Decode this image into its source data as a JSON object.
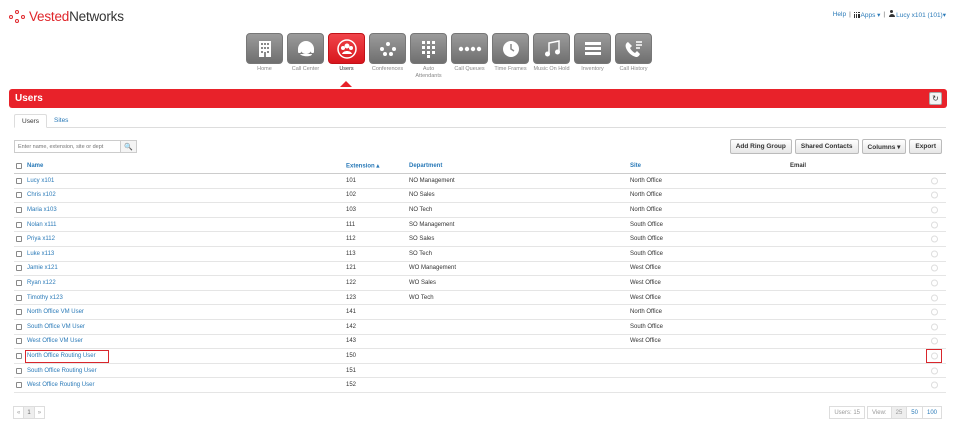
{
  "brand": {
    "name_first": "Vested",
    "name_second": "Networks"
  },
  "topbar": {
    "help": "Help",
    "sep": "|",
    "apps": "Apps",
    "user": "Lucy x101 (101)",
    "caret": "▾"
  },
  "nav": [
    {
      "label": "Home",
      "icon": "building-icon"
    },
    {
      "label": "Call Center",
      "icon": "headset-icon"
    },
    {
      "label": "Users",
      "icon": "users-icon",
      "active": true
    },
    {
      "label": "Conferences",
      "icon": "conference-icon"
    },
    {
      "label": "Auto Attendants",
      "icon": "keypad-icon"
    },
    {
      "label": "Call Queues",
      "icon": "queue-icon"
    },
    {
      "label": "Time Frames",
      "icon": "clock-icon"
    },
    {
      "label": "Music On Hold",
      "icon": "music-icon"
    },
    {
      "label": "Inventory",
      "icon": "inventory-icon"
    },
    {
      "label": "Call History",
      "icon": "call-history-icon"
    }
  ],
  "page": {
    "title": "Users",
    "refresh_icon": "↻"
  },
  "tabs": {
    "users": "Users",
    "sites": "Sites"
  },
  "search": {
    "placeholder": "Enter name, extension, site or dept",
    "icon": "🔍"
  },
  "toolbar": {
    "add_ring_group": "Add Ring Group",
    "shared_contacts": "Shared Contacts",
    "columns": "Columns ▾",
    "export": "Export"
  },
  "table": {
    "headers": {
      "name": "Name",
      "extension": "Extension ▴",
      "department": "Department",
      "site": "Site",
      "email": "Email"
    },
    "rows": [
      {
        "name": "Lucy x101",
        "ext": "101",
        "dept": "NO Management",
        "site": "North Office"
      },
      {
        "name": "Chris x102",
        "ext": "102",
        "dept": "NO Sales",
        "site": "North Office"
      },
      {
        "name": "Maria x103",
        "ext": "103",
        "dept": "NO Tech",
        "site": "North Office"
      },
      {
        "name": "Nolan x111",
        "ext": "111",
        "dept": "SO Management",
        "site": "South Office"
      },
      {
        "name": "Priya x112",
        "ext": "112",
        "dept": "SO Sales",
        "site": "South Office"
      },
      {
        "name": "Luke x113",
        "ext": "113",
        "dept": "SO Tech",
        "site": "South Office"
      },
      {
        "name": "Jamie x121",
        "ext": "121",
        "dept": "WO Management",
        "site": "West Office"
      },
      {
        "name": "Ryan x122",
        "ext": "122",
        "dept": "WO Sales",
        "site": "West Office"
      },
      {
        "name": "Timothy x123",
        "ext": "123",
        "dept": "WO Tech",
        "site": "West Office"
      },
      {
        "name": "North Office VM User",
        "ext": "141",
        "dept": "",
        "site": "North Office"
      },
      {
        "name": "South Office VM User",
        "ext": "142",
        "dept": "",
        "site": "South Office"
      },
      {
        "name": "West Office VM User",
        "ext": "143",
        "dept": "",
        "site": "West Office"
      },
      {
        "name": "North Office Routing User",
        "ext": "150",
        "dept": "",
        "site": ""
      },
      {
        "name": "South Office Routing User",
        "ext": "151",
        "dept": "",
        "site": ""
      },
      {
        "name": "West Office Routing User",
        "ext": "152",
        "dept": "",
        "site": ""
      }
    ]
  },
  "pager": {
    "prev": "«",
    "page": "1",
    "next": "»"
  },
  "footer": {
    "count": "Users: 15",
    "view_label": "View:",
    "view_25": "25",
    "view_50": "50",
    "view_100": "100"
  },
  "colors": {
    "accent": "#e8222a",
    "link": "#2a7ab8"
  }
}
